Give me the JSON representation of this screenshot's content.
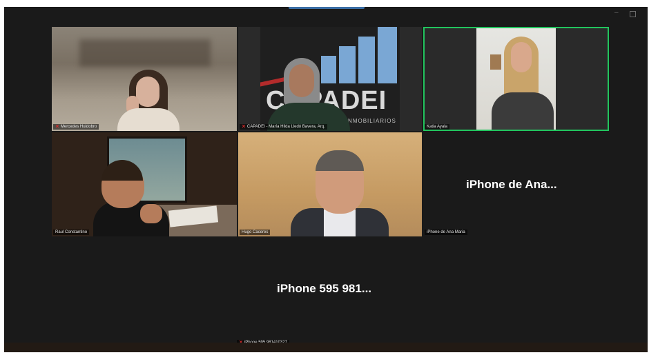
{
  "colors": {
    "background": "#1a1a1a",
    "active_speaker_border": "#22c55e",
    "mute_icon": "#e02b2b",
    "label_text": "#eaeaea"
  },
  "participants": [
    {
      "name": "Mercedes Huidobro",
      "muted": true,
      "video": true
    },
    {
      "name": "CAPADEI - María Hilda Lledó Bavera, Arq.",
      "muted": true,
      "video": true,
      "background_text": {
        "logo": "CAPADEI",
        "subtitle": "GUAYA DE ... INMOBILIARIOS"
      }
    },
    {
      "name": "Katia Ayala",
      "muted": false,
      "video": true,
      "active_speaker": true
    },
    {
      "name": "Raul Constantino",
      "muted": false,
      "video": true
    },
    {
      "name": "Hugo Caceres",
      "muted": false,
      "video": true
    },
    {
      "name": "iPhone de Ana Maria",
      "display_name": "iPhone de Ana...",
      "muted": false,
      "video": false
    },
    {
      "name": "iPhone 595 981410327",
      "display_name": "iPhone 595 981...",
      "muted": true,
      "video": false
    }
  ],
  "mute_glyph": "🎤̸",
  "icons": {
    "mute": "muted-mic-icon",
    "minimize": "minimize-icon",
    "maximize": "maximize-icon"
  }
}
